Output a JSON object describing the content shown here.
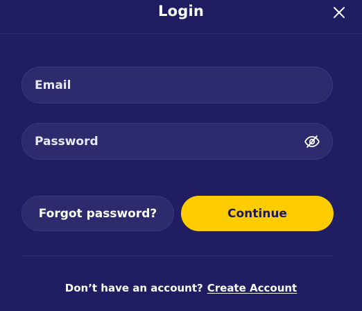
{
  "header": {
    "title": "Login",
    "close_icon": "close-icon"
  },
  "form": {
    "email": {
      "placeholder": "Email",
      "value": ""
    },
    "password": {
      "placeholder": "Password",
      "value": "",
      "toggle_icon": "eye-slash-icon"
    }
  },
  "actions": {
    "forgot_label": "Forgot password?",
    "continue_label": "Continue"
  },
  "footer": {
    "prompt": "Don’t have an account?",
    "link_label": "Create Account"
  },
  "colors": {
    "background": "#211d62",
    "field": "#2d2a6e",
    "accent": "#ffcc00",
    "text": "#ffffff"
  }
}
